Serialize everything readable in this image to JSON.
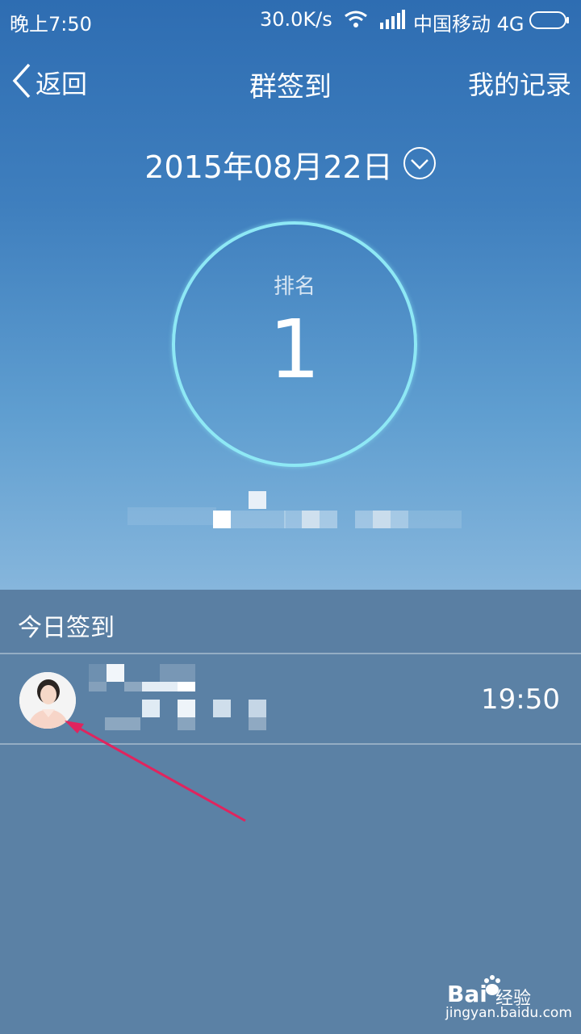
{
  "status_bar": {
    "time": "晚上7:50",
    "network_speed": "30.0K/s",
    "carrier": "中国移动 4G",
    "icons": [
      "wifi-icon",
      "signal-icon",
      "battery-icon"
    ]
  },
  "nav": {
    "back_label": "返回",
    "title": "群签到",
    "records_label": "我的记录"
  },
  "date_selector": {
    "date": "2015年08月22日",
    "icon": "chevron-down-circle-icon"
  },
  "rank": {
    "label": "排名",
    "value": "1"
  },
  "today_section": {
    "title": "今日签到",
    "entries": [
      {
        "time": "19:50",
        "avatar": "avatar"
      }
    ]
  },
  "watermark": {
    "brand": "Bai",
    "sub": "经验",
    "url": "jingyan.baidu.com"
  },
  "colors": {
    "accent_ring": "#8ee8f5",
    "section_bg": "#5b81a5",
    "annotation_arrow": "#e0245e"
  }
}
